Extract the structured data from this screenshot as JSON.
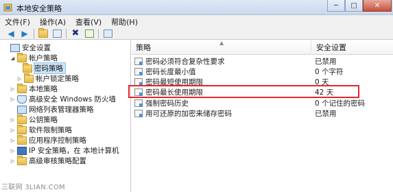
{
  "window": {
    "title": "本地安全策略",
    "minimize": "─",
    "maximize": "□",
    "close": "✕"
  },
  "menu": [
    "文件(F)",
    "操作(A)",
    "查看(V)",
    "帮助(H)"
  ],
  "toolbar": {
    "back": "◀",
    "forward": "▶",
    "delete": "✖"
  },
  "tree": {
    "root": "安全设置",
    "account_policies": "帐户策略",
    "password_policy": "密码策略",
    "lockout_policy": "帐户锁定策略",
    "local_policies": "本地策略",
    "firewall": "高级安全 Windows 防火墙",
    "network_list": "网络列表管理器策略",
    "public_key": "公钥策略",
    "software_restriction": "软件限制策略",
    "app_control": "应用程序控制策略",
    "ipsec": "IP 安全策略，在 本地计算机",
    "audit": "高级审核策略配置"
  },
  "columns": {
    "policy": "策略",
    "setting": "安全设置"
  },
  "policies": [
    {
      "name": "密码必须符合复杂性要求",
      "value": "已禁用"
    },
    {
      "name": "密码长度最小值",
      "value": "0 个字符"
    },
    {
      "name": "密码最短使用期限",
      "value": "0 天"
    },
    {
      "name": "密码最长使用期限",
      "value": "42 天"
    },
    {
      "name": "强制密码历史",
      "value": "0 个记住的密码"
    },
    {
      "name": "用可还原的加密来储存密码",
      "value": "已禁用"
    }
  ],
  "highlighted_policy": "密码最长使用期限",
  "watermark": "三联网 3LIAN.COM",
  "colors": {
    "highlight_border": "#e4262b",
    "selection": "#cce4f7",
    "titlebar": "#c8d8ec"
  }
}
